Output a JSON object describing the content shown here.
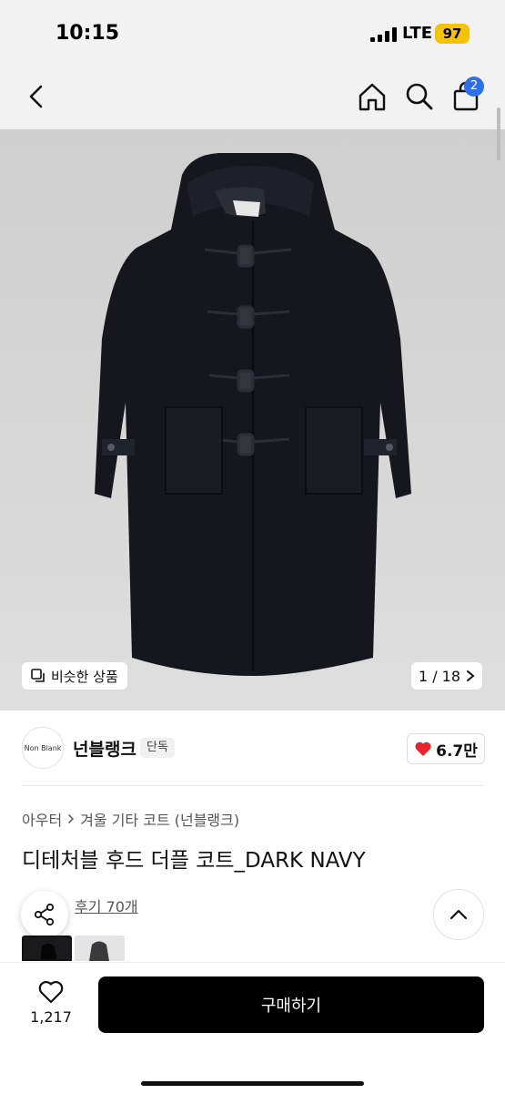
{
  "status": {
    "time": "10:15",
    "network": "LTE",
    "battery": "97"
  },
  "nav": {
    "cart_count": "2"
  },
  "gallery": {
    "similar_label": "비슷한 상품",
    "counter": "1 / 18"
  },
  "brand": {
    "logo_text": "Non Blank",
    "name": "넌블랭크",
    "tag": "단독",
    "likes": "6.7만"
  },
  "breadcrumb": {
    "category": "아우터",
    "subcategory": "겨울 기타 코트 (넌블랭크)"
  },
  "product": {
    "title": "디테처블 후드 더플 코트_DARK NAVY",
    "reviews": "후기 70개"
  },
  "bottom": {
    "like_count": "1,217",
    "buy_label": "구매하기"
  },
  "colors": {
    "buy_button": "#000000",
    "badge": "#2f6fe8",
    "battery": "#f5c400",
    "heart": "#e8232e"
  }
}
